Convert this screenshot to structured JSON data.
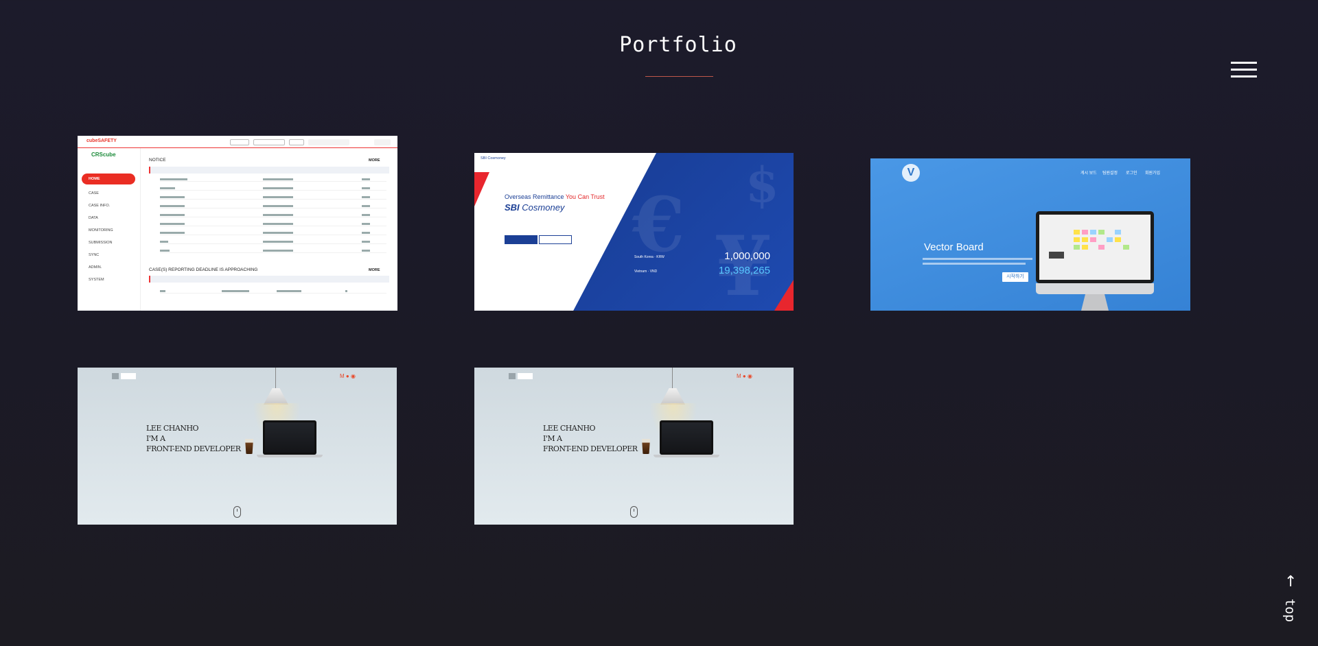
{
  "header": {
    "title": "Portfolio",
    "menu_icon": "hamburger-icon"
  },
  "colors": {
    "background": "#1c1b2b",
    "accent_underline": "#c0574a",
    "text": "#ffffff"
  },
  "portfolio": {
    "items": [
      {
        "id": "crscube-safety",
        "logo": "cubeSAFETY",
        "side_brand": "CRScube",
        "nav": [
          "HOME",
          "CASE",
          "CASE INFO.",
          "DATA",
          "MONITORING",
          "SUBMISSION",
          "SYNC",
          "ADMIN.",
          "SYSTEM"
        ],
        "section_1": "NOTICE",
        "section_2": "CASE(S) REPORTING DEADLINE IS APPROACHING",
        "more": "MORE"
      },
      {
        "id": "sbi-cosmoney",
        "logo": "SBI Cosmoney",
        "headline_prefix": "Overseas Remittance ",
        "headline_emphasis": "You Can Trust",
        "brand_prefix": "SBI",
        "brand_suffix": " Cosmoney",
        "send_currency": "South Korea · KRW",
        "send_amount": "1,000,000",
        "receive_currency": "Vietnam · VND",
        "receive_amount": "19,398,265"
      },
      {
        "id": "vector-board",
        "logo_letter": "V",
        "menu": [
          "게시 보드",
          "팀원설정",
          "로그인",
          "회원가입"
        ],
        "title": "Vector Board",
        "cta": "시작하기"
      },
      {
        "id": "developer-portfolio-1",
        "line_1": "LEE CHANHO",
        "line_2": "I'M A",
        "line_3": "FRONT-END DEVELOPER"
      },
      {
        "id": "developer-portfolio-2",
        "line_1": "LEE CHANHO",
        "line_2": "I'M A",
        "line_3": "FRONT-END DEVELOPER"
      }
    ]
  },
  "top_button": {
    "label": "top",
    "icon": "arrow-up-icon"
  }
}
